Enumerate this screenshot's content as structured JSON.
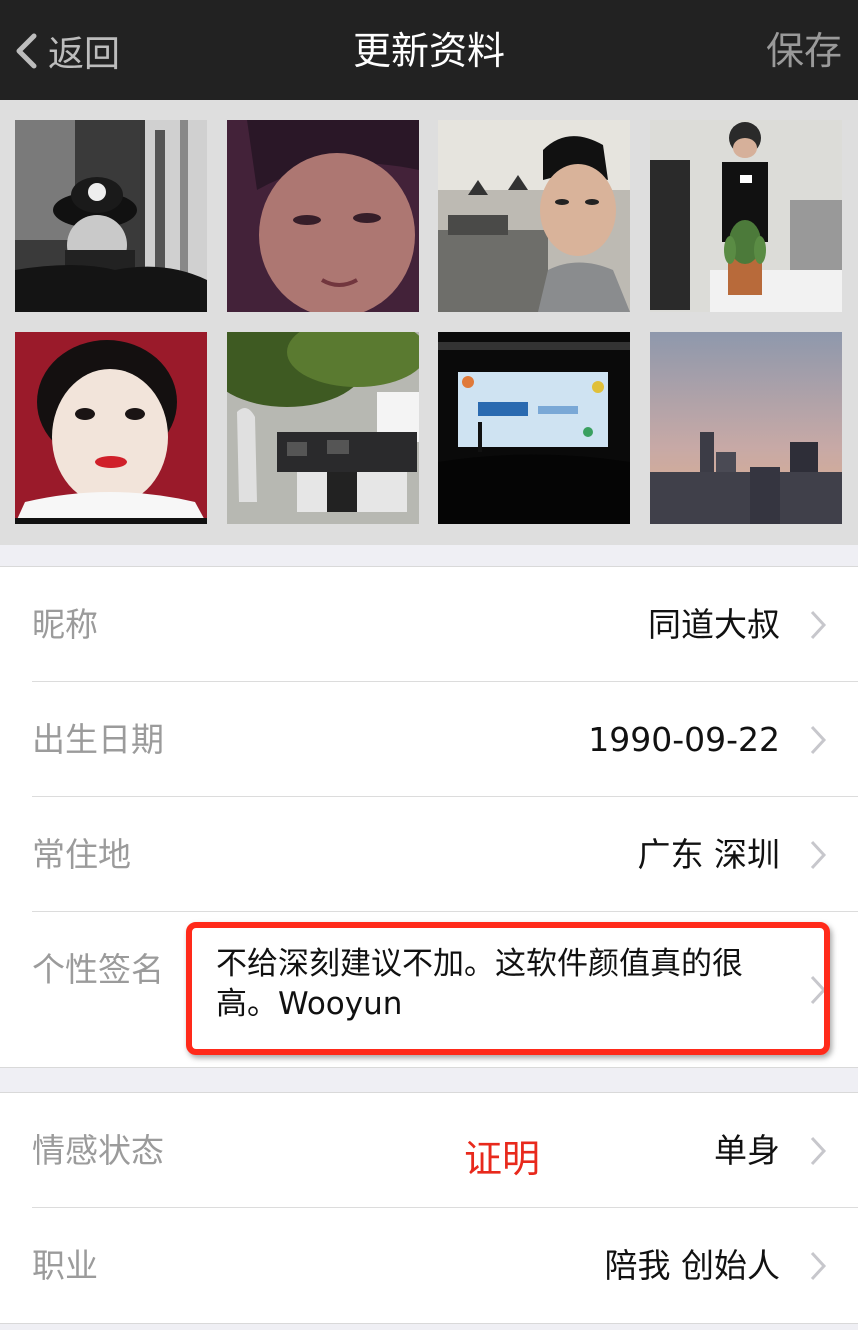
{
  "navbar": {
    "back_label": "返回",
    "title": "更新资料",
    "save_label": "保存"
  },
  "photos": [
    {
      "name": "photo-selfie-cap-bw",
      "desc": "black and white selfie with cap"
    },
    {
      "name": "photo-selfie-closeup",
      "desc": "close-up selfie, purple tint"
    },
    {
      "name": "photo-selfie-office",
      "desc": "selfie in office"
    },
    {
      "name": "photo-office-cactus",
      "desc": "man at office with cactus"
    },
    {
      "name": "photo-id-portrait",
      "desc": "red background portrait"
    },
    {
      "name": "photo-office-tree",
      "desc": "office with indoor tree"
    },
    {
      "name": "photo-stage-screen",
      "desc": "stage screen presentation"
    },
    {
      "name": "photo-city-sunset",
      "desc": "city skyline at dusk"
    }
  ],
  "profile": {
    "nickname_label": "昵称",
    "nickname_value": "同道大叔",
    "birthday_label": "出生日期",
    "birthday_value": "1990-09-22",
    "residence_label": "常住地",
    "residence_value": "广东 深圳",
    "signature_label": "个性签名",
    "signature_value": "不给深刻建议不加。这软件颜值真的很高。Wooyun",
    "relationship_label": "情感状态",
    "relationship_value": "单身",
    "job_label": "职业",
    "job_value": "陪我 创始人"
  },
  "annotation": {
    "text": "证明",
    "color": "#e8291c"
  },
  "colors": {
    "navbar_bg": "#222222",
    "label_gray": "#9b9b9b",
    "background": "#efeff4"
  }
}
